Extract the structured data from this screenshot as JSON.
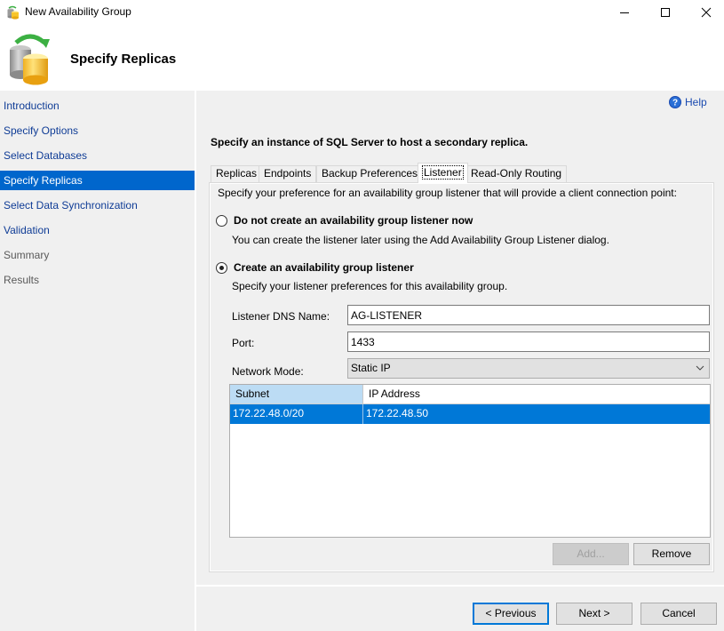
{
  "window": {
    "title": "New Availability Group",
    "controls": {
      "minimize": "minimize",
      "maximize": "maximize",
      "close": "close"
    }
  },
  "header": {
    "title": "Specify Replicas",
    "icon": "availability-group-databases-icon"
  },
  "sidebar": {
    "items": [
      {
        "label": "Introduction",
        "state": "link"
      },
      {
        "label": "Specify Options",
        "state": "link"
      },
      {
        "label": "Select Databases",
        "state": "link"
      },
      {
        "label": "Specify Replicas",
        "state": "active"
      },
      {
        "label": "Select Data Synchronization",
        "state": "link"
      },
      {
        "label": "Validation",
        "state": "link"
      },
      {
        "label": "Summary",
        "state": "disabled"
      },
      {
        "label": "Results",
        "state": "disabled"
      }
    ]
  },
  "main": {
    "help_label": "Help",
    "instruction": "Specify an instance of SQL Server to host a secondary replica.",
    "tabs": [
      {
        "label": "Replicas",
        "active": false
      },
      {
        "label": "Endpoints",
        "active": false
      },
      {
        "label": "Backup Preferences",
        "active": false
      },
      {
        "label": "Listener",
        "active": true
      },
      {
        "label": "Read-Only Routing",
        "active": false
      }
    ],
    "listener": {
      "description": "Specify your preference for an availability group listener that will provide a client connection point:",
      "option_none": {
        "label": "Do not create an availability group listener now",
        "sub": "You can create the listener later using the Add Availability Group Listener dialog.",
        "checked": false
      },
      "option_create": {
        "label": "Create an availability group listener",
        "sub": "Specify your listener preferences for this availability group.",
        "checked": true
      },
      "dns_label": "Listener DNS Name:",
      "dns_value": "AG-LISTENER",
      "port_label": "Port:",
      "port_value": "1433",
      "mode_label": "Network Mode:",
      "mode_value": "Static IP",
      "grid": {
        "columns": [
          "Subnet",
          "IP Address"
        ],
        "rows": [
          {
            "subnet": "172.22.48.0/20",
            "ip": "172.22.48.50",
            "selected": true
          }
        ]
      },
      "add_label": "Add...",
      "remove_label": "Remove"
    }
  },
  "footer": {
    "previous_label": "< Previous",
    "next_label": "Next >",
    "cancel_label": "Cancel"
  },
  "colors": {
    "accent": "#0066cc",
    "selection": "#0078d7",
    "link": "#0f3c96",
    "panel_bg": "#f0f0f0"
  }
}
